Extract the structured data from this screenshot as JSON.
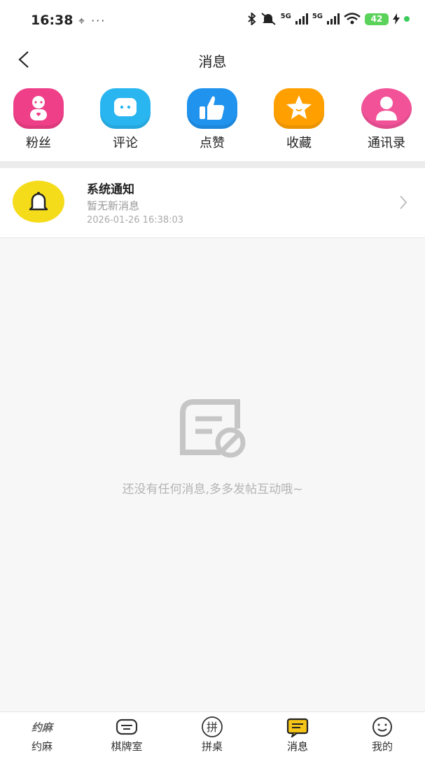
{
  "status_bar": {
    "time": "16:38",
    "left_icons": "⌖ ···",
    "network_1": "5G",
    "network_2": "5G",
    "battery": "42"
  },
  "nav": {
    "title": "消息"
  },
  "shortcuts": [
    {
      "label": "粉丝",
      "icon": "fans-icon",
      "color": "#ef3f88"
    },
    {
      "label": "评论",
      "icon": "comment-icon",
      "color": "#29b6f0"
    },
    {
      "label": "点赞",
      "icon": "thumbs-up-icon",
      "color": "#1f93ee"
    },
    {
      "label": "收藏",
      "icon": "star-icon",
      "color": "#ffa000"
    },
    {
      "label": "通讯录",
      "icon": "contacts-icon",
      "color": "#f25298"
    }
  ],
  "notice": {
    "title": "系统通知",
    "subtitle": "暂无新消息",
    "time": "2026-01-26 16:38:03",
    "avatar_color": "#f5dc1a"
  },
  "empty_state": {
    "text": "还没有任何消息,多多发帖互动哦~"
  },
  "tabs": [
    {
      "label": "约麻",
      "icon": "yuema-icon"
    },
    {
      "label": "棋牌室",
      "icon": "card-room-icon"
    },
    {
      "label": "拼桌",
      "icon": "pin-table-icon",
      "glyph": "拼"
    },
    {
      "label": "消息",
      "icon": "message-icon",
      "active": true
    },
    {
      "label": "我的",
      "icon": "smile-icon"
    }
  ]
}
